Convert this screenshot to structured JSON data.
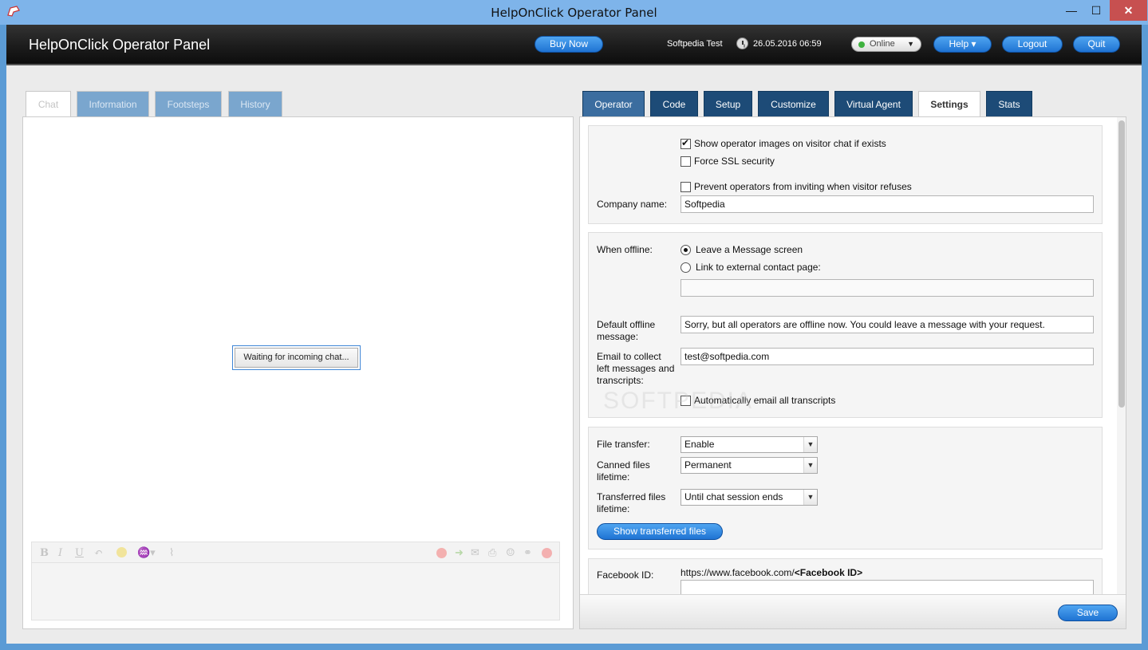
{
  "window": {
    "title": "HelpOnClick Operator Panel",
    "minimize": "—",
    "maximize": "☐",
    "close": "✕"
  },
  "header": {
    "title": "HelpOnClick Operator Panel",
    "buy_now": "Buy Now",
    "user": "Softpedia Test",
    "datetime": "26.05.2016 06:59",
    "status": "Online",
    "help": "Help ▾",
    "logout": "Logout",
    "quit": "Quit"
  },
  "left_tabs": [
    "Chat",
    "Information",
    "Footsteps",
    "History"
  ],
  "chat": {
    "waiting": "Waiting for incoming chat..."
  },
  "toolbar": {
    "bold": "B",
    "italic": "I",
    "underline": "U"
  },
  "right_tabs": [
    "Operator",
    "Code",
    "Setup",
    "Customize",
    "Virtual Agent",
    "Settings",
    "Stats"
  ],
  "settings": {
    "show_operator_images": "Show operator images on visitor chat if exists",
    "force_ssl": "Force SSL security",
    "prevent_inviting": "Prevent operators from inviting when visitor refuses",
    "company_name_label": "Company name:",
    "company_name_value": "Softpedia",
    "when_offline_label": "When offline:",
    "leave_message": "Leave a Message screen",
    "link_external": "Link to external contact page:",
    "external_url_value": "",
    "default_offline_label": "Default offline message:",
    "default_offline_value": "Sorry, but all operators are offline now. You could leave a message with your request.",
    "email_collect_label": "Email to collect left messages and transcripts:",
    "email_value": "test@softpedia.com",
    "auto_email": "Automatically email all transcripts",
    "file_transfer_label": "File transfer:",
    "file_transfer_value": "Enable",
    "canned_files_label": "Canned files lifetime:",
    "canned_files_value": "Permanent",
    "transferred_files_label": "Transferred files lifetime:",
    "transferred_files_value": "Until chat session ends",
    "show_transferred": "Show transferred files",
    "facebook_label": "Facebook ID:",
    "facebook_prefix": "https://www.facebook.com/",
    "facebook_placeholder": "<Facebook ID>",
    "facebook_value": "",
    "save": "Save"
  },
  "watermark": "SOFTPEDIA"
}
